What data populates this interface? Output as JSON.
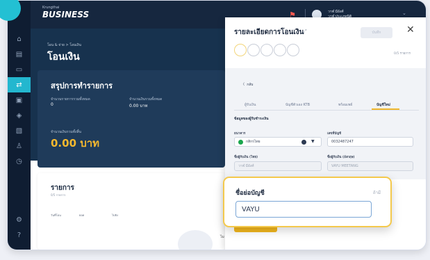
{
  "app": {
    "logo": "BUSINESS",
    "logo_small": "Krungthai"
  },
  "user": {
    "name_line1": "วาฬ มีอังศ์",
    "name_line2": "วาฬ ประเภทนิติ"
  },
  "page": {
    "breadcrumb": "โอน & จ่าย > โอนเงิน",
    "title": "โอนเงิน"
  },
  "summary": {
    "title": "สรุปการทำรายการ",
    "count_label": "จำนวนรายการรวมทั้งหมด",
    "count_value": "0",
    "amount_label": "จำนวนเงินรวมทั้งหมด",
    "amount_value": "0.00 บาท",
    "total_label": "จำนวนเงินรวมทั้งสิ้น",
    "total_value": "0.00 บาท"
  },
  "list": {
    "title": "รายการ",
    "subtitle": "0/5 รายการ",
    "columns": [
      "วันที่โอน",
      "ยอด",
      "ไปยัง"
    ],
    "footer_text": "ไม"
  },
  "panel": {
    "title": "รายละเอียดการโอนเงิน",
    "save_label": "บันทึก",
    "step_count": "0/5 รายการ",
    "back_label": "กลับ",
    "tabs": [
      "ผู้รับเงิน",
      "บัญชีตัวเอง KTB",
      "พร้อมเพย์",
      "บัญชีใหม่"
    ],
    "active_tab": "บัญชีใหม่",
    "section_title": "ข้อมูลของผู้รับชำระเงิน",
    "bank_label": "ธนาคาร",
    "bank_value": "กสิกรไทย",
    "account_label": "เลขที่บัญชี",
    "account_value": "0032487247",
    "name_th_label": "ชื่อผู้รับเงิน (ไทย)",
    "name_th_value": "วาฬ มีอังศ์",
    "name_en_label": "ชื่อผู้รับเงิน (อังกฤษ)",
    "name_en_value": "VAYU MEETANG",
    "add_button": "เพิ่มรายการโอน"
  },
  "callout": {
    "label": "ชื่อย่อบัญชี",
    "optional": "ถ้ามี",
    "value": "VAYU"
  },
  "colors": {
    "accent": "#23b7cf",
    "highlight": "#f4c94c",
    "nav": "#0f1d32"
  },
  "icons": [
    "home-icon",
    "doc-icon",
    "wallet-icon",
    "transfer-icon",
    "card-icon",
    "tag-icon",
    "file-icon",
    "users-icon",
    "clock-icon",
    "settings-icon",
    "help-icon",
    "flag-icon",
    "avatar-icon"
  ]
}
